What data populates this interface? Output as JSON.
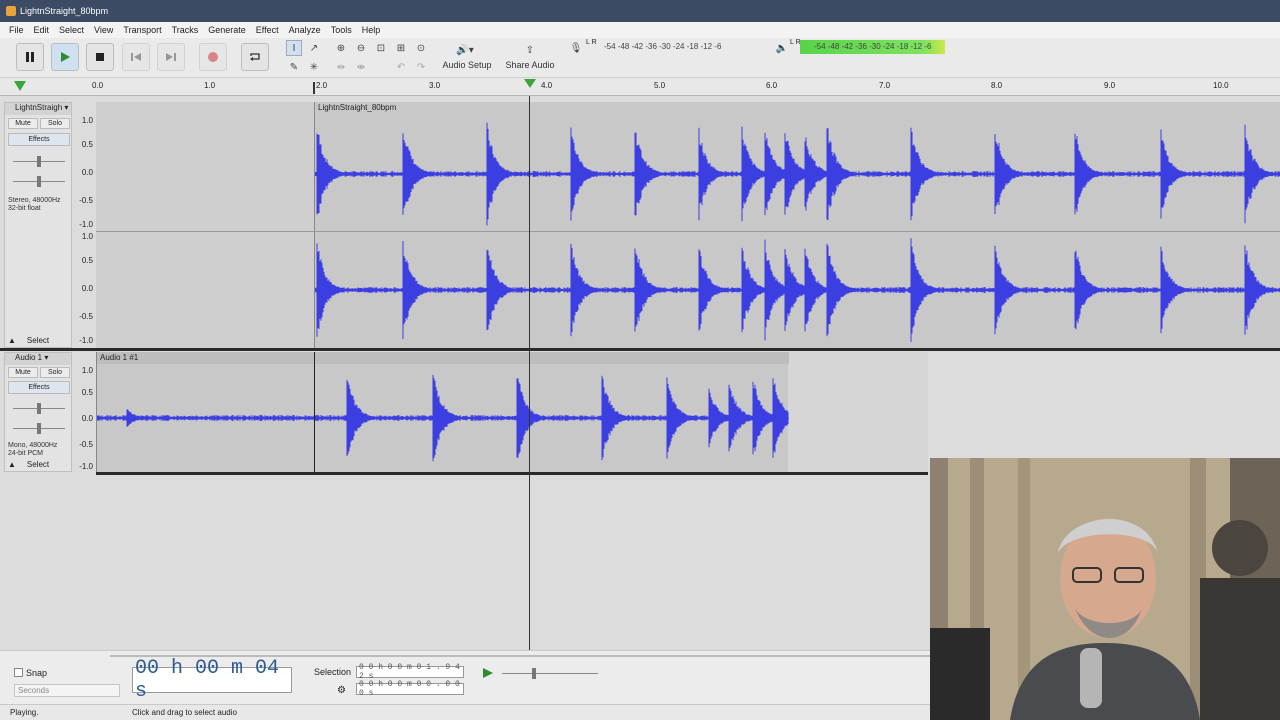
{
  "window": {
    "title": "LightnStraight_80bpm"
  },
  "menu": [
    "File",
    "Edit",
    "Select",
    "View",
    "Transport",
    "Tracks",
    "Generate",
    "Effect",
    "Analyze",
    "Tools",
    "Help"
  ],
  "toolbar": {
    "audio_setup_label": "Audio Setup",
    "share_audio_label": "Share Audio",
    "record_meter_scale": "-54 -48 -42 -36 -30 -24 -18 -12 -6",
    "play_meter_scale": "-54 -48 -42 -36 -30 -24 -18 -12 -6",
    "record_lr": "L R",
    "play_lr": "L R"
  },
  "ruler": {
    "ticks": [
      "0.0",
      "1.0",
      "2.0",
      "3.0",
      "4.0",
      "5.0",
      "6.0",
      "7.0",
      "8.0",
      "9.0",
      "10.0"
    ]
  },
  "tracks": [
    {
      "name": "LightnStraigh",
      "mute": "Mute",
      "solo": "Solo",
      "effects": "Effects",
      "info_line1": "Stereo, 48000Hz",
      "info_line2": "32-bit float",
      "select": "Select",
      "clip_name": "LightnStraight_80bpm",
      "scale": [
        "1.0",
        "0.5",
        "0.0",
        "-0.5",
        "-1.0"
      ]
    },
    {
      "name": "Audio 1",
      "mute": "Mute",
      "solo": "Solo",
      "effects": "Effects",
      "info_line1": "Mono, 48000Hz",
      "info_line2": "24-bit PCM",
      "select": "Select",
      "clip_name": "Audio 1 #1",
      "scale": [
        "1.0",
        "0.5",
        "0.0",
        "-0.5",
        "-1.0"
      ]
    }
  ],
  "bottom": {
    "snap_label": "Snap",
    "snap_unit": "Seconds",
    "time_display": "00 h 00 m 04 s",
    "selection_label": "Selection",
    "selection_start": "0 0 h 0 0 m 0 1 . 9 4 2 s",
    "selection_end": "0 0 h 0 0 m 0 0 . 0 0 0 s"
  },
  "status": {
    "state": "Playing.",
    "hint": "Click and drag to select audio"
  },
  "colors": {
    "waveform": "#3b3ee0",
    "titlebar": "#3c4a63",
    "meter_green": "#58d34a"
  }
}
